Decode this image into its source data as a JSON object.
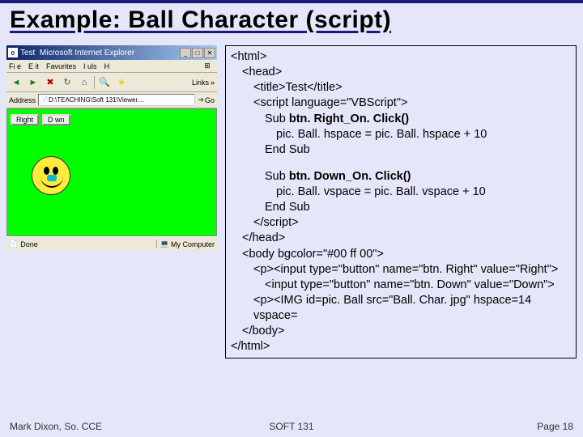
{
  "title": "Example: Ball Character (script)",
  "ie": {
    "title_prefix": "Test",
    "title_suffix": "Microsoft Internet Explorer",
    "menu": [
      "Fi e",
      "E it",
      "Favurites",
      "I uls",
      "H"
    ],
    "links_label": "Links",
    "address_label": "Address",
    "address_value": "D:\\TEACHING\\Soft 131\\Viewer…",
    "go_label": "Go",
    "buttons": {
      "right": "Right",
      "down": "D  wn"
    },
    "status_done": "Done",
    "status_mycomputer": "My Computer"
  },
  "code": {
    "l1": "<html>",
    "l2": "<head>",
    "l3": "<title>Test</title>",
    "l4": "<script language=\"VBScript\">",
    "l5a": "Sub ",
    "l5b": "btn. Right_On. Click()",
    "l6": "pic. Ball. hspace = pic. Ball. hspace + 10",
    "l7": "End Sub",
    "l8a": "Sub ",
    "l8b": "btn. Down_On. Click()",
    "l9": "pic. Ball. vspace = pic. Ball. vspace + 10",
    "l10": "End Sub",
    "l11": "</script>",
    "l12": "</head>",
    "l13": "<body bgcolor=\"#00 ff 00\">",
    "l14": "<p><input type=\"button\" name=\"btn. Right\" value=\"Right\">",
    "l15": "<input type=\"button\" name=\"btn. Down\"  value=\"Down\">",
    "l16": "<p><IMG id=pic. Ball src=\"Ball. Char. jpg\" hspace=14 vspace=",
    "l17": "</body>",
    "l18": "</html>"
  },
  "footer": {
    "left": "Mark Dixon, So. CCE",
    "mid": "SOFT 131",
    "right": "Page 18"
  }
}
